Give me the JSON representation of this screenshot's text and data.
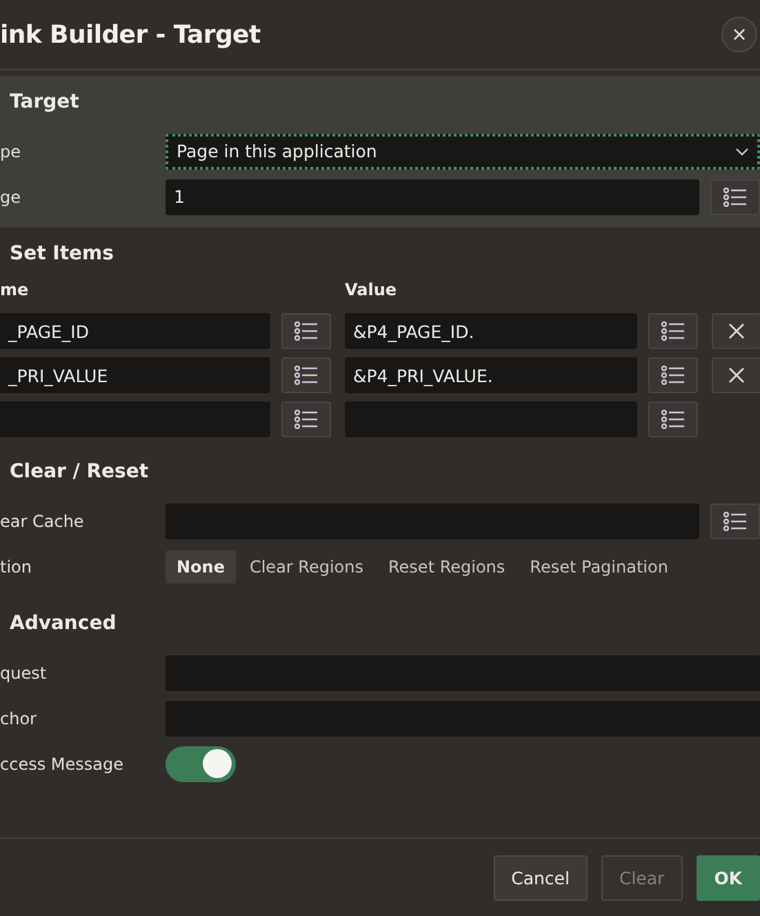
{
  "dialog": {
    "title": "ink Builder - Target",
    "close_label": "×"
  },
  "target": {
    "heading": "Target",
    "type": {
      "label": "pe",
      "value": "Page in this application"
    },
    "page": {
      "label": "ge",
      "value": "1"
    }
  },
  "set_items": {
    "heading": "Set Items",
    "columns": [
      "me",
      "Value"
    ],
    "rows": [
      {
        "name": "_PAGE_ID",
        "value": "&P4_PAGE_ID.",
        "removable": true
      },
      {
        "name": "_PRI_VALUE",
        "value": "&P4_PRI_VALUE.",
        "removable": true
      },
      {
        "removable": false
      }
    ]
  },
  "clear_reset": {
    "heading": "Clear / Reset",
    "clear_cache": {
      "label": "ear Cache"
    },
    "action": {
      "label": "tion",
      "options": [
        {
          "label": "None",
          "selected": true
        },
        {
          "label": "Clear Regions",
          "selected": false
        },
        {
          "label": "Reset Regions",
          "selected": false
        },
        {
          "label": "Reset Pagination",
          "selected": false
        }
      ]
    }
  },
  "advanced": {
    "heading": "Advanced",
    "request": {
      "label": "quest"
    },
    "anchor": {
      "label": "chor"
    },
    "success_message": {
      "label": "ccess Message",
      "on": true
    }
  },
  "buttons": [
    {
      "label": "Cancel",
      "kind": "default",
      "disabled": false
    },
    {
      "label": "Clear",
      "kind": "default",
      "disabled": true
    },
    {
      "label": "OK",
      "kind": "primary",
      "disabled": false
    }
  ]
}
